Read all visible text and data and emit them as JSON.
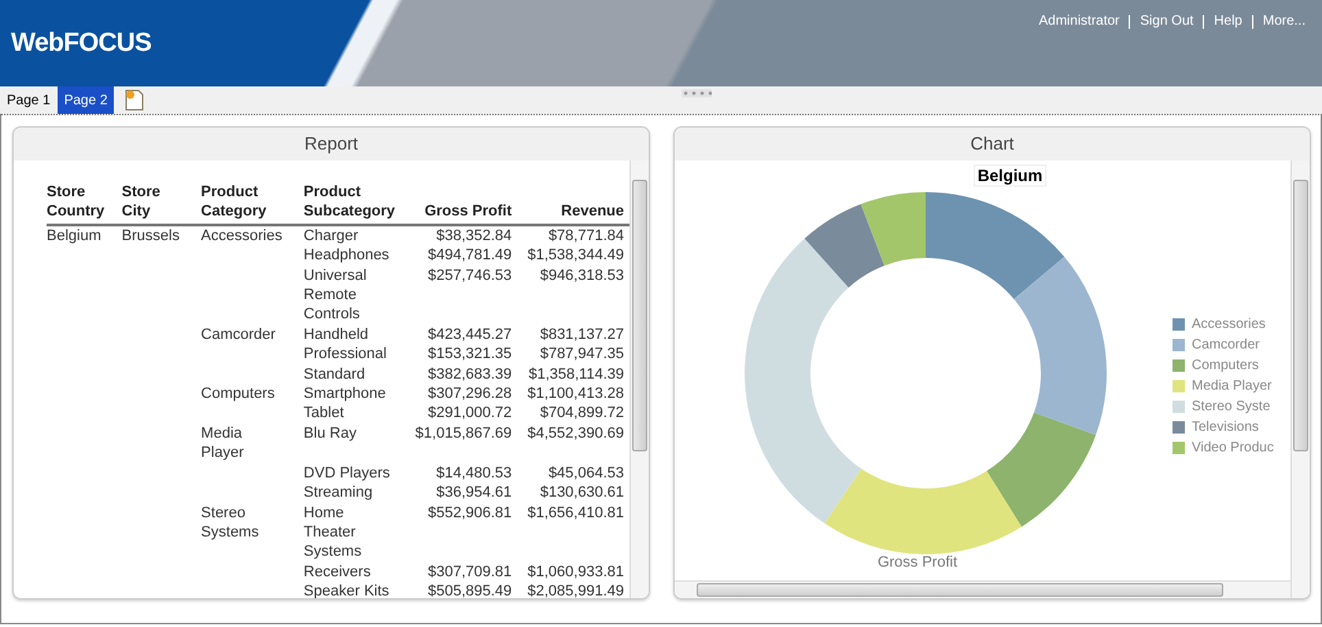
{
  "header": {
    "logo": "WebFOCUS",
    "links": [
      "Administrator",
      "Sign Out",
      "Help",
      "More..."
    ]
  },
  "tabs": [
    {
      "label": "Page 1",
      "selected": false
    },
    {
      "label": "Page 2",
      "selected": true
    }
  ],
  "report": {
    "title": "Report",
    "columns": [
      "Store Country",
      "Store City",
      "Product Category",
      "Product Subcategory",
      "Gross Profit",
      "Revenue"
    ],
    "rows": [
      {
        "country": "Belgium",
        "city": "Brussels",
        "category": "Accessories",
        "subcategory": "Charger",
        "gross_profit": "$38,352.84",
        "revenue": "$78,771.84"
      },
      {
        "subcategory": "Headphones",
        "gross_profit": "$494,781.49",
        "revenue": "$1,538,344.49"
      },
      {
        "subcategory": "Universal Remote Controls",
        "gross_profit": "$257,746.53",
        "revenue": "$946,318.53"
      },
      {
        "category": "Camcorder",
        "subcategory": "Handheld",
        "gross_profit": "$423,445.27",
        "revenue": "$831,137.27"
      },
      {
        "subcategory": "Professional",
        "gross_profit": "$153,321.35",
        "revenue": "$787,947.35"
      },
      {
        "subcategory": "Standard",
        "gross_profit": "$382,683.39",
        "revenue": "$1,358,114.39"
      },
      {
        "category": "Computers",
        "subcategory": "Smartphone",
        "gross_profit": "$307,296.28",
        "revenue": "$1,100,413.28"
      },
      {
        "subcategory": "Tablet",
        "gross_profit": "$291,000.72",
        "revenue": "$704,899.72"
      },
      {
        "category": "Media Player",
        "subcategory": "Blu Ray",
        "gross_profit": "$1,015,867.69",
        "revenue": "$4,552,390.69"
      },
      {
        "subcategory": "DVD Players",
        "gross_profit": "$14,480.53",
        "revenue": "$45,064.53"
      },
      {
        "subcategory": "Streaming",
        "gross_profit": "$36,954.61",
        "revenue": "$130,630.61"
      },
      {
        "category": "Stereo Systems",
        "subcategory": "Home Theater Systems",
        "gross_profit": "$552,906.81",
        "revenue": "$1,656,410.81"
      },
      {
        "subcategory": "Receivers",
        "gross_profit": "$307,709.81",
        "revenue": "$1,060,933.81"
      },
      {
        "subcategory": "Speaker Kits",
        "gross_profit": "$505,895.49",
        "revenue": "$2,085,991.49"
      }
    ]
  },
  "chart_panel": {
    "title": "Chart",
    "chart_title": "Belgium",
    "axis_label": "Gross Profit",
    "legend": [
      {
        "label": "Accessories",
        "color": "#6e93b0"
      },
      {
        "label": "Camcorder",
        "color": "#9cb6d0"
      },
      {
        "label": "Computers",
        "color": "#8db36c"
      },
      {
        "label": "Media Player",
        "color": "#e0e47e"
      },
      {
        "label": "Stereo Syste",
        "color": "#cfdde1"
      },
      {
        "label": "Televisions",
        "color": "#7a8c9c"
      },
      {
        "label": "Video Produc",
        "color": "#a3c66a"
      }
    ]
  }
}
